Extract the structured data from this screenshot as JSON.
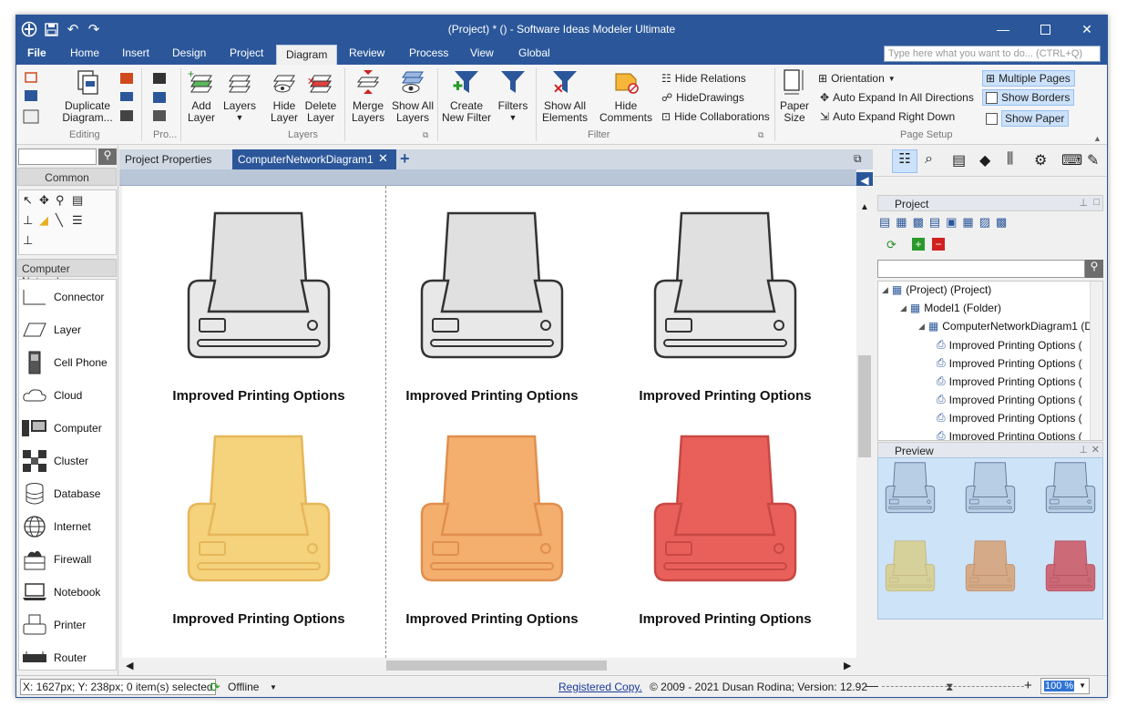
{
  "window": {
    "title": "(Project) * () - Software Ideas Modeler Ultimate",
    "minimize_icon": "minimize-icon",
    "maximize_icon": "maximize-icon",
    "close_icon": "close-icon"
  },
  "menu": {
    "items": [
      "File",
      "Home",
      "Insert",
      "Design",
      "Project",
      "Diagram",
      "Review",
      "Process",
      "View",
      "Global"
    ],
    "active": "Diagram",
    "search_placeholder": "Type here what you want to do... (CTRL+Q)"
  },
  "ribbon": {
    "editing": {
      "duplicate": "Duplicate\nDiagram...",
      "group": "Editing"
    },
    "pro_group": "Pro...",
    "layers": {
      "add": "Add\nLayer",
      "layers": "Layers",
      "hide": "Hide\nLayer",
      "delete": "Delete\nLayer",
      "merge": "Merge\nLayers",
      "show_all": "Show All\nLayers",
      "group": "Layers"
    },
    "filter": {
      "create": "Create\nNew Filter",
      "filters": "Filters",
      "show_all": "Show All\nElements",
      "hide_comments": "Hide\nComments",
      "hide_relations": "Hide Relations",
      "hide_drawings": "HideDrawings",
      "hide_collaborations": "Hide Collaborations",
      "group": "Filter"
    },
    "page_setup": {
      "paper_size": "Paper\nSize",
      "orientation": "Orientation",
      "auto_expand_all": "Auto Expand In All Directions",
      "auto_expand_right": "Auto Expand Right Down",
      "multiple_pages": "Multiple Pages",
      "show_borders": "Show Borders",
      "show_paper": "Show Paper",
      "group": "Page Setup"
    }
  },
  "left_panel": {
    "common": "Common",
    "category": "Computer  Network...",
    "shapes": [
      "Connector",
      "Layer",
      "Cell Phone",
      "Cloud",
      "Computer",
      "Cluster",
      "Database",
      "Internet",
      "Firewall",
      "Notebook",
      "Printer",
      "Router"
    ]
  },
  "tabs": {
    "project_properties": "Project Properties",
    "diagram": "ComputerNetworkDiagram1"
  },
  "canvas": {
    "printers": [
      {
        "label": "Improved Printing Options",
        "fill": "#e8e8e8",
        "paper": "#e0e0e0",
        "stroke": "#333333"
      },
      {
        "label": "Improved Printing Options",
        "fill": "#e8e8e8",
        "paper": "#e0e0e0",
        "stroke": "#333333"
      },
      {
        "label": "Improved Printing Options",
        "fill": "#e8e8e8",
        "paper": "#e0e0e0",
        "stroke": "#333333"
      },
      {
        "label": "Improved Printing Options",
        "fill": "#f5d27c",
        "paper": "#f5d27c",
        "stroke": "#e6b75a"
      },
      {
        "label": "Improved Printing Options",
        "fill": "#f4ae6e",
        "paper": "#f4ae6e",
        "stroke": "#e08f4e"
      },
      {
        "label": "Improved Printing Options",
        "fill": "#e9605b",
        "paper": "#e9605b",
        "stroke": "#c84844"
      }
    ]
  },
  "right_panel": {
    "project_title": "Project",
    "tree": [
      {
        "label": "(Project) (Project)",
        "level": 0
      },
      {
        "label": "Model1 (Folder)",
        "level": 1
      },
      {
        "label": "ComputerNetworkDiagram1 (Di",
        "level": 2
      },
      {
        "label": "Improved Printing Options (",
        "level": 3
      },
      {
        "label": "Improved Printing Options (",
        "level": 3
      },
      {
        "label": "Improved Printing Options (",
        "level": 3
      },
      {
        "label": "Improved Printing Options (",
        "level": 3
      },
      {
        "label": "Improved Printing Options (",
        "level": 3
      },
      {
        "label": "Improved Printing Options (",
        "level": 3
      }
    ],
    "preview_title": "Preview"
  },
  "status": {
    "coords": "X: 1627px; Y: 238px; 0 item(s) selected",
    "offline": "Offline",
    "registered": "Registered Copy.",
    "copyright": "© 2009 - 2021 Dusan Rodina; Version: 12.92",
    "zoom": "100 %"
  }
}
